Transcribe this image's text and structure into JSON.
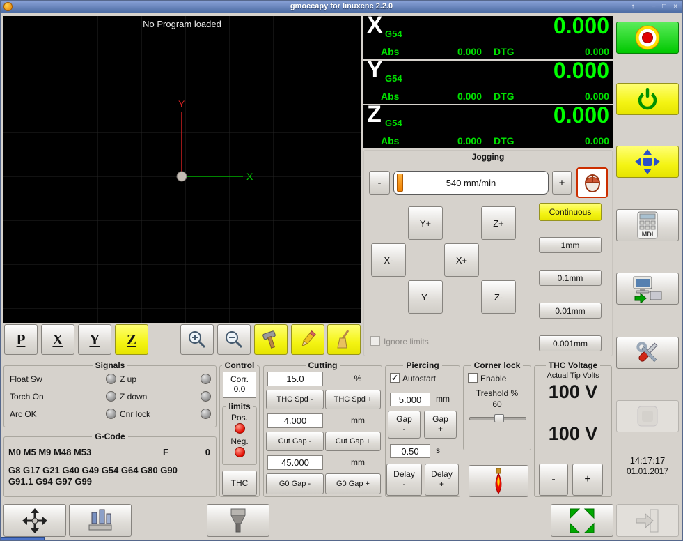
{
  "window": {
    "title": "gmoccapy for linuxcnc  2.2.0",
    "shade": "↑",
    "minimize": "−",
    "maximize": "□",
    "close": "×"
  },
  "glyphs": {
    "check": "✓"
  },
  "colors": {
    "dro_value_green": "#00ff00",
    "dro_label_green": "#00e000",
    "estop_button_green": "#00c800",
    "accent_yellow": "#f4f414",
    "led_red": "#e30b00",
    "led_off_gray": "#9a9a9a",
    "titlebar_blue": "#5d7cb8",
    "preview_background": "#000000"
  },
  "preview": {
    "message": "No Program loaded",
    "x_axis": "X",
    "y_axis": "Y",
    "view_buttons": {
      "p": "P",
      "x": "X",
      "y": "Y",
      "z": "Z"
    }
  },
  "dro": {
    "axes": [
      {
        "letter": "X",
        "system": "G54",
        "value": "0.000",
        "abs_label": "Abs",
        "abs_value": "0.000",
        "dtg_label": "DTG",
        "dtg_value": "0.000"
      },
      {
        "letter": "Y",
        "system": "G54",
        "value": "0.000",
        "abs_label": "Abs",
        "abs_value": "0.000",
        "dtg_label": "DTG",
        "dtg_value": "0.000"
      },
      {
        "letter": "Z",
        "system": "G54",
        "value": "0.000",
        "abs_label": "Abs",
        "abs_value": "0.000",
        "dtg_label": "DTG",
        "dtg_value": "0.000"
      }
    ]
  },
  "jogging": {
    "title": "Jogging",
    "feed_minus": "-",
    "feed_plus": "+",
    "feed_text": "540 mm/min",
    "continuous": "Continuous",
    "jog": {
      "y_plus": "Y+",
      "z_plus": "Z+",
      "x_minus": "X-",
      "x_plus": "X+",
      "y_minus": "Y-",
      "z_minus": "Z-"
    },
    "increments": [
      "1mm",
      "0.1mm",
      "0.01mm",
      "0.001mm"
    ],
    "ignore_limits": "Ignore limits"
  },
  "signals": {
    "title": "Signals",
    "rows": [
      {
        "left": "Float Sw",
        "right": "Z up"
      },
      {
        "left": "Torch On",
        "right": "Z down"
      },
      {
        "left": "Arc OK",
        "right": "Cnr lock"
      }
    ]
  },
  "gcode": {
    "title": "G-Code",
    "m_codes": "M0 M5 M9 M48 M53",
    "feed_label": "F",
    "feed_value": "0",
    "g_codes": "G8 G17 G21 G40 G49 G54 G64 G80 G90 G91.1 G94 G97 G99"
  },
  "control": {
    "title": "Control",
    "corr_label": "Corr.",
    "corr_value": "0.0",
    "limits_title": "limits",
    "pos": "Pos.",
    "neg": "Neg.",
    "thc": "THC"
  },
  "cutting": {
    "title": "Cutting",
    "speed_value": "15.0",
    "speed_unit": "%",
    "thc_spd_minus": "THC Spd -",
    "thc_spd_plus": "THC Spd +",
    "cut_gap_value": "4.000",
    "cut_gap_unit": "mm",
    "cut_gap_minus": "Cut Gap -",
    "cut_gap_plus": "Cut Gap +",
    "g0_gap_value": "45.000",
    "g0_gap_unit": "mm",
    "g0_gap_minus": "G0 Gap -",
    "g0_gap_plus": "G0 Gap +"
  },
  "piercing": {
    "title": "Piercing",
    "autostart": "Autostart",
    "gap_value": "5.000",
    "gap_unit": "mm",
    "gap_label": "Gap",
    "minus": "-",
    "plus": "+",
    "delay_value": "0.50",
    "delay_unit": "s",
    "delay_label": "Delay"
  },
  "corner_lock": {
    "title": "Corner lock",
    "enable": "Enable",
    "threshold_label": "Treshold %",
    "threshold_value": "60"
  },
  "thc_voltage": {
    "title": "THC Voltage",
    "subtitle": "Actual Tip Volts",
    "volts_actual": "100 V",
    "volts_target": "100 V",
    "minus": "-",
    "plus": "+"
  },
  "clock": {
    "time": "14:17:17",
    "date": "01.01.2017"
  },
  "right_panel": {
    "mdi_label": "MDI"
  }
}
